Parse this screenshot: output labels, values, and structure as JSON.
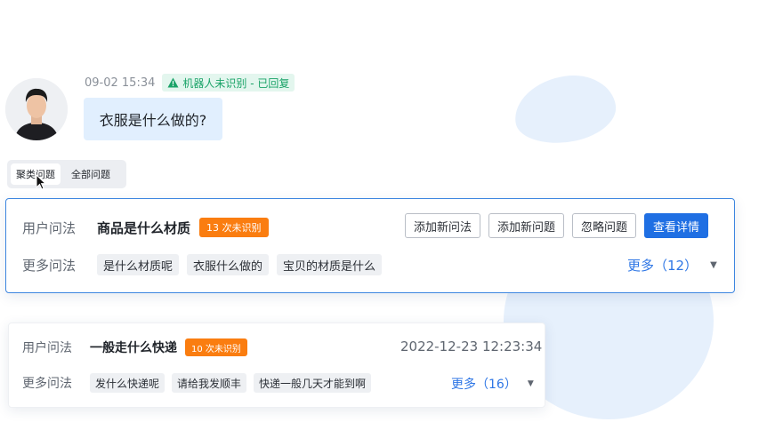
{
  "message": {
    "timestamp": "09-02 15:34",
    "status_tag": "机器人未识别 - 已回复",
    "text": "衣服是什么做的?"
  },
  "tabs": [
    {
      "label": "聚类问题",
      "active": true
    },
    {
      "label": "全部问题",
      "active": false
    }
  ],
  "cards": [
    {
      "user_label": "用户问法",
      "question": "商品是什么材质",
      "unrecognized": "13 次未识别",
      "buttons": {
        "add_phrase": "添加新问法",
        "add_question": "添加新问题",
        "ignore": "忽略问题",
        "details": "查看详情"
      },
      "more_label": "更多问法",
      "variants": [
        "是什么材质呢",
        "衣服什么做的",
        "宝贝的材质是什么"
      ],
      "more_link": "更多（12）"
    },
    {
      "user_label": "用户问法",
      "question": "一般走什么快递",
      "unrecognized": "10 次未识别",
      "datetime": "2022-12-23 12:23:34",
      "more_label": "更多问法",
      "variants": [
        "发什么快递呢",
        "请给我发顺丰",
        "快递一般几天才能到啊"
      ],
      "more_link": "更多（16）"
    }
  ],
  "colors": {
    "primary": "#1f6fe3",
    "badge_orange": "#fa7d10",
    "success_green": "#1aa368",
    "bubble_blue": "#e1effe"
  },
  "icons": {
    "status": "warning-triangle-icon",
    "expand": "caret-down-icon",
    "pointer": "mouse-pointer-icon"
  }
}
